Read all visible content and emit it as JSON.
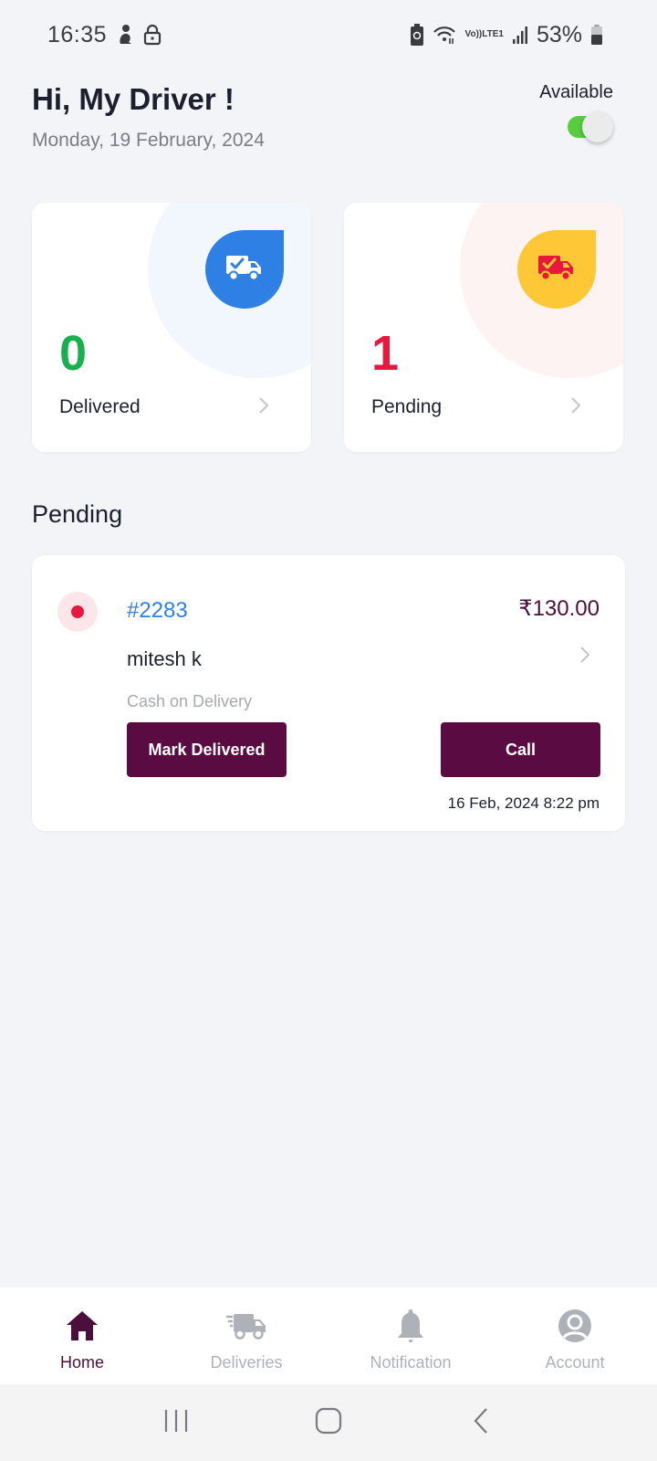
{
  "status_bar": {
    "time": "16:35",
    "network_label_top": "Vo))",
    "network_label_bottom": "LTE1",
    "battery_percent": "53%",
    "icons": [
      "driver-notification-icon",
      "lock-icon",
      "battery-saver-icon",
      "wifi-icon",
      "volte-icon",
      "signal-icon",
      "battery-icon"
    ]
  },
  "header": {
    "greeting": "Hi, My Driver !",
    "date": "Monday, 19 February, 2024",
    "availability_label": "Available",
    "availability_on": true
  },
  "stats": [
    {
      "count": "0",
      "label": "Delivered",
      "icon": "truck-check-icon",
      "bubble_color": "#2f80e5",
      "count_color": "#18b04e"
    },
    {
      "count": "1",
      "label": "Pending",
      "icon": "truck-check-icon",
      "bubble_color": "#fdc735",
      "count_color": "#e8173d"
    }
  ],
  "section": {
    "title": "Pending"
  },
  "orders": [
    {
      "id": "#2283",
      "price": "₹130.00",
      "customer": "mitesh k",
      "payment_method": "Cash on Delivery",
      "mark_delivered_label": "Mark Delivered",
      "call_label": "Call",
      "timestamp": "16 Feb, 2024 8:22 pm",
      "status_color": "#e8173d"
    }
  ],
  "bottom_nav": {
    "items": [
      {
        "label": "Home",
        "icon": "home-icon",
        "active": true
      },
      {
        "label": "Deliveries",
        "icon": "delivery-truck-icon",
        "active": false
      },
      {
        "label": "Notification",
        "icon": "bell-icon",
        "active": false
      },
      {
        "label": "Account",
        "icon": "account-icon",
        "active": false
      }
    ]
  },
  "theme": {
    "accent": "#5a0c42",
    "background": "#f3f4f8",
    "link_blue": "#2f80e5",
    "toggle_green": "#57cc3f"
  }
}
